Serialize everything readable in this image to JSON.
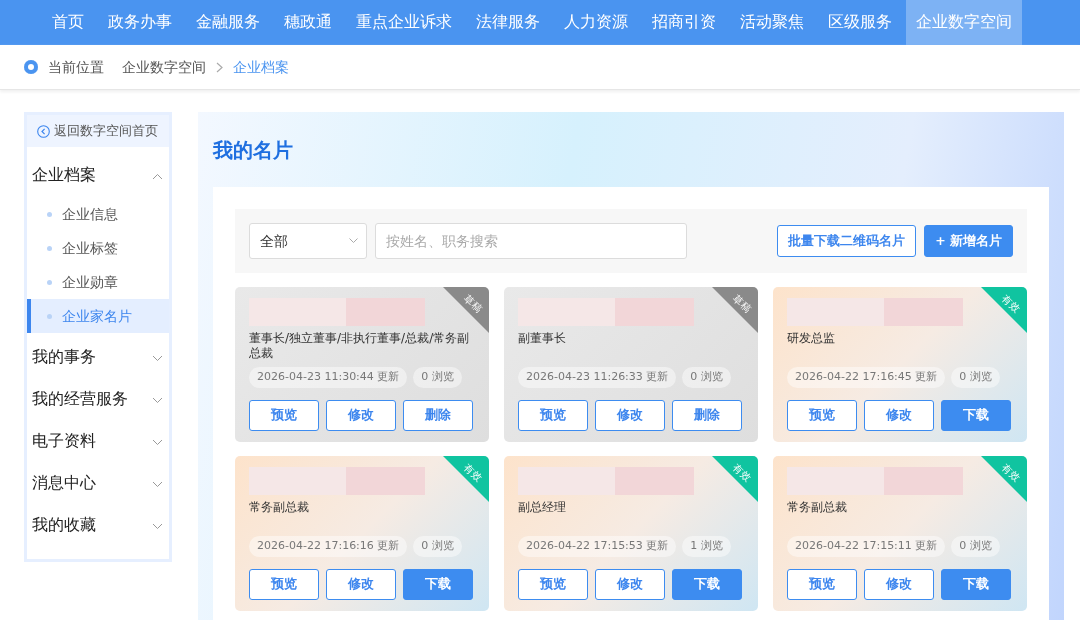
{
  "nav": [
    {
      "label": "首页",
      "selected": false
    },
    {
      "label": "政务办事",
      "selected": false
    },
    {
      "label": "金融服务",
      "selected": false
    },
    {
      "label": "穗政通",
      "selected": false
    },
    {
      "label": "重点企业诉求",
      "selected": false
    },
    {
      "label": "法律服务",
      "selected": false
    },
    {
      "label": "人力资源",
      "selected": false
    },
    {
      "label": "招商引资",
      "selected": false
    },
    {
      "label": "活动聚焦",
      "selected": false
    },
    {
      "label": "区级服务",
      "selected": false
    },
    {
      "label": "企业数字空间",
      "selected": true
    }
  ],
  "breadcrumb": {
    "label": "当前位置",
    "items": [
      {
        "label": "企业数字空间",
        "current": false
      },
      {
        "label": "企业档案",
        "current": true
      }
    ]
  },
  "sidebar": {
    "back": "返回数字空间首页",
    "groups": [
      {
        "label": "企业档案",
        "expanded": true,
        "children": [
          {
            "label": "企业信息",
            "selected": false
          },
          {
            "label": "企业标签",
            "selected": false
          },
          {
            "label": "企业勋章",
            "selected": false
          },
          {
            "label": "企业家名片",
            "selected": true
          }
        ]
      },
      {
        "label": "我的事务",
        "expanded": false
      },
      {
        "label": "我的经营服务",
        "expanded": false
      },
      {
        "label": "电子资料",
        "expanded": false
      },
      {
        "label": "消息中心",
        "expanded": false
      },
      {
        "label": "我的收藏",
        "expanded": false
      }
    ]
  },
  "page_title": "我的名片",
  "toolbar": {
    "filter": "全部",
    "search": {
      "placeholder": "按姓名、职务搜索"
    },
    "buttons": [
      {
        "label": "批量下载二维码名片",
        "kind": "outline"
      },
      {
        "label": "+ 新增名片",
        "kind": "primary"
      }
    ]
  },
  "cards": [
    {
      "status": {
        "label": "草稿",
        "kind": "draft"
      },
      "title": "董事长/独立董事/非执行董事/总裁/常务副总裁",
      "updated": "2026-04-23 11:30:44 更新",
      "views": "0 浏览",
      "actions": [
        {
          "label": "预览",
          "kind": "outline"
        },
        {
          "label": "修改",
          "kind": "outline"
        },
        {
          "label": "删除",
          "kind": "outline"
        }
      ]
    },
    {
      "status": {
        "label": "草稿",
        "kind": "draft"
      },
      "title": "副董事长",
      "updated": "2026-04-23 11:26:33 更新",
      "views": "0 浏览",
      "actions": [
        {
          "label": "预览",
          "kind": "outline"
        },
        {
          "label": "修改",
          "kind": "outline"
        },
        {
          "label": "删除",
          "kind": "outline"
        }
      ]
    },
    {
      "status": {
        "label": "有效",
        "kind": "valid"
      },
      "title": "研发总监",
      "updated": "2026-04-22 17:16:45 更新",
      "views": "0 浏览",
      "actions": [
        {
          "label": "预览",
          "kind": "outline"
        },
        {
          "label": "修改",
          "kind": "outline"
        },
        {
          "label": "下载",
          "kind": "primary"
        }
      ]
    },
    {
      "status": {
        "label": "有效",
        "kind": "valid"
      },
      "title": "常务副总裁",
      "updated": "2026-04-22 17:16:16 更新",
      "views": "0 浏览",
      "actions": [
        {
          "label": "预览",
          "kind": "outline"
        },
        {
          "label": "修改",
          "kind": "outline"
        },
        {
          "label": "下载",
          "kind": "primary"
        }
      ]
    },
    {
      "status": {
        "label": "有效",
        "kind": "valid"
      },
      "title": "副总经理",
      "updated": "2026-04-22 17:15:53 更新",
      "views": "1 浏览",
      "actions": [
        {
          "label": "预览",
          "kind": "outline"
        },
        {
          "label": "修改",
          "kind": "outline"
        },
        {
          "label": "下载",
          "kind": "primary"
        }
      ]
    },
    {
      "status": {
        "label": "有效",
        "kind": "valid"
      },
      "title": "常务副总裁",
      "updated": "2026-04-22 17:15:11 更新",
      "views": "0 浏览",
      "actions": [
        {
          "label": "预览",
          "kind": "outline"
        },
        {
          "label": "修改",
          "kind": "outline"
        },
        {
          "label": "下载",
          "kind": "primary"
        }
      ]
    }
  ]
}
